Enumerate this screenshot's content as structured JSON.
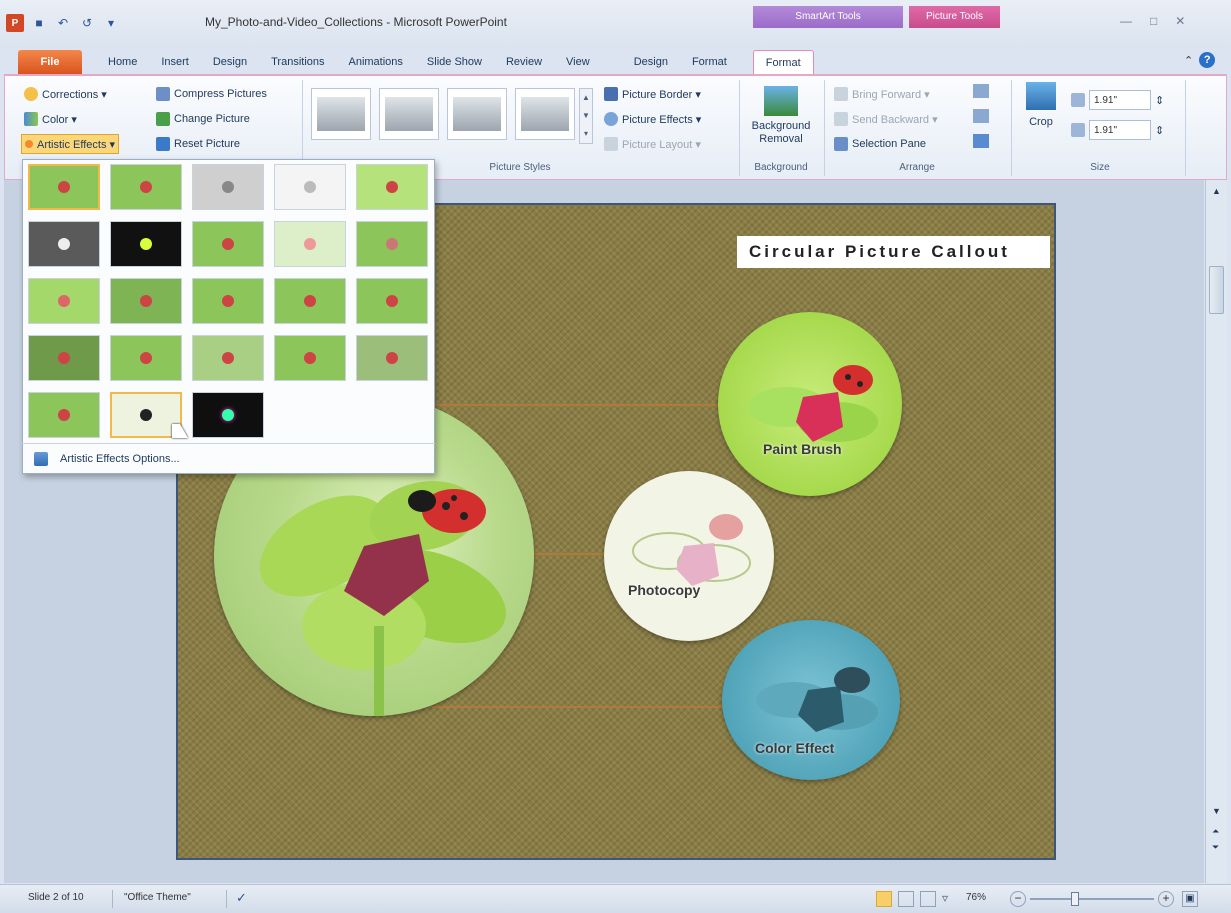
{
  "window": {
    "title": "My_Photo-and-Video_Collections - Microsoft PowerPoint"
  },
  "context_tabs": {
    "smartart": "SmartArt Tools",
    "picture": "Picture Tools"
  },
  "tabs": [
    "File",
    "Home",
    "Insert",
    "Design",
    "Transitions",
    "Animations",
    "Slide Show",
    "Review",
    "View",
    "Design",
    "Format",
    "Format"
  ],
  "ribbon": {
    "adjust": {
      "corrections": "Corrections ▾",
      "color": "Color ▾",
      "artistic": "Artistic Effects ▾",
      "compress": "Compress Pictures",
      "change": "Change Picture",
      "reset": "Reset Picture"
    },
    "styles": {
      "border": "Picture Border ▾",
      "effects": "Picture Effects ▾",
      "layout": "Picture Layout ▾",
      "label": "Picture Styles"
    },
    "background": {
      "removal": "Background Removal",
      "label": "Background"
    },
    "arrange": {
      "forward": "Bring Forward ▾",
      "backward": "Send Backward ▾",
      "pane": "Selection Pane",
      "label": "Arrange"
    },
    "size": {
      "crop": "Crop",
      "height": "1.91\"",
      "width": "1.91\"",
      "label": "Size"
    }
  },
  "gallery": {
    "options": "Artistic Effects Options..."
  },
  "slide": {
    "title": "Circular Picture Callout",
    "labels": {
      "paint": "Paint Brush",
      "photocopy": "Photocopy",
      "color": "Color Effect"
    }
  },
  "status": {
    "slide": "Slide 2 of 10",
    "theme": "\"Office Theme\"",
    "zoom": "76%"
  },
  "colors": {
    "file_tab": "#d9541e",
    "picture_tools": "#c94c8c",
    "smartart_tools": "#9b6cc9",
    "slide_bg": "#8a7d44"
  }
}
